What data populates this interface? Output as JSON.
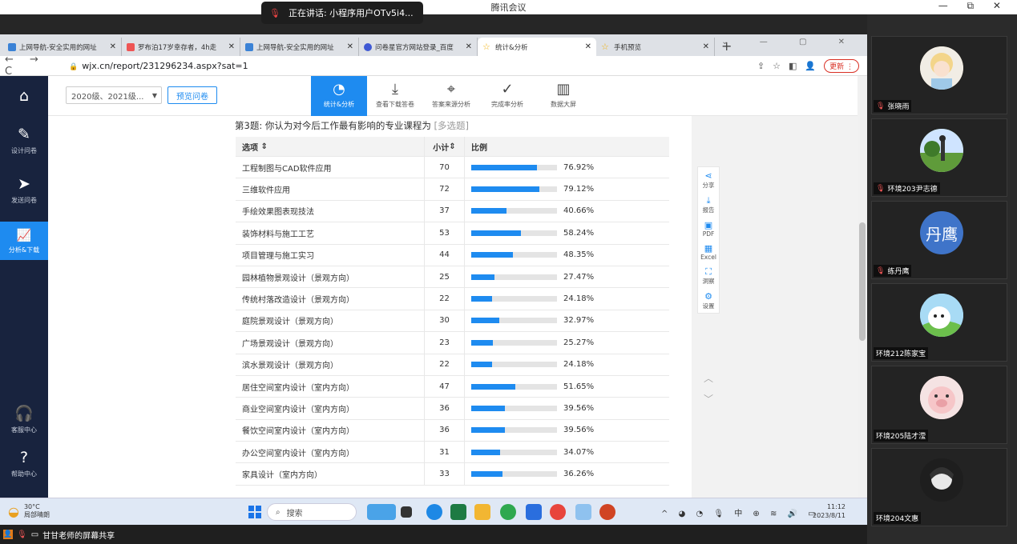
{
  "meeting": {
    "app_title": "腾讯会议",
    "window_controls": "— ⧉ ✕",
    "speaking_label": "正在讲话: 小程序用户OTv5i4...",
    "share_label": "甘甘老师的屏幕共享"
  },
  "browser": {
    "tabs": [
      {
        "label": "上网导航-安全实用的网址",
        "icon": "nav-icon",
        "active": false
      },
      {
        "label": "罗布泊17岁幸存者，4h走",
        "icon": "video-icon",
        "active": false
      },
      {
        "label": "上网导航-安全实用的网址",
        "icon": "nav-icon",
        "active": false
      },
      {
        "label": "问卷星官方网站登录_百度",
        "icon": "paw-icon",
        "active": false
      },
      {
        "label": "统计&分析",
        "icon": "star-icon",
        "active": true
      },
      {
        "label": "手机预览",
        "icon": "star-icon",
        "active": false
      }
    ],
    "url": "wjx.cn/report/231296234.aspx?sat=1",
    "update_label": "更新"
  },
  "sidebar": {
    "items": [
      {
        "label": "设计问卷",
        "icon": "edit-icon"
      },
      {
        "label": "发送问卷",
        "icon": "send-icon"
      },
      {
        "label": "分析&下载",
        "icon": "chart-icon",
        "active": true
      },
      {
        "label": "客服中心",
        "icon": "headset-icon"
      },
      {
        "label": "帮助中心",
        "icon": "help-icon"
      }
    ]
  },
  "toolbar": {
    "year_select": "2020级、2021级...",
    "preview_button": "预览问卷",
    "tools": [
      {
        "label": "统计&分析",
        "icon": "pie-icon",
        "active": true
      },
      {
        "label": "查看下载答卷",
        "icon": "download-icon"
      },
      {
        "label": "答案来源分析",
        "icon": "target-icon"
      },
      {
        "label": "完成率分析",
        "icon": "check-icon"
      },
      {
        "label": "数据大屏",
        "icon": "dashboard-icon"
      }
    ]
  },
  "question": {
    "title": "第3题: 你认为对今后工作最有影响的专业课程为",
    "type_tag": "[多选题]",
    "headers": {
      "option": "选项",
      "count": "小计",
      "ratio": "比例"
    },
    "rows": [
      {
        "option": "工程制图与CAD软件应用",
        "count": "70",
        "percent": "76.92%",
        "value": 76.92
      },
      {
        "option": "三维软件应用",
        "count": "72",
        "percent": "79.12%",
        "value": 79.12
      },
      {
        "option": "手绘效果图表现技法",
        "count": "37",
        "percent": "40.66%",
        "value": 40.66
      },
      {
        "option": "装饰材料与施工工艺",
        "count": "53",
        "percent": "58.24%",
        "value": 58.24
      },
      {
        "option": "项目管理与施工实习",
        "count": "44",
        "percent": "48.35%",
        "value": 48.35
      },
      {
        "option": "园林植物景观设计（景观方向）",
        "count": "25",
        "percent": "27.47%",
        "value": 27.47
      },
      {
        "option": "传统村落改造设计（景观方向）",
        "count": "22",
        "percent": "24.18%",
        "value": 24.18
      },
      {
        "option": "庭院景观设计（景观方向）",
        "count": "30",
        "percent": "32.97%",
        "value": 32.97
      },
      {
        "option": "广场景观设计（景观方向）",
        "count": "23",
        "percent": "25.27%",
        "value": 25.27
      },
      {
        "option": "滨水景观设计（景观方向）",
        "count": "22",
        "percent": "24.18%",
        "value": 24.18
      },
      {
        "option": "居住空间室内设计（室内方向）",
        "count": "47",
        "percent": "51.65%",
        "value": 51.65
      },
      {
        "option": "商业空间室内设计（室内方向）",
        "count": "36",
        "percent": "39.56%",
        "value": 39.56
      },
      {
        "option": "餐饮空间室内设计（室内方向）",
        "count": "36",
        "percent": "39.56%",
        "value": 39.56
      },
      {
        "option": "办公空间室内设计（室内方向）",
        "count": "31",
        "percent": "34.07%",
        "value": 34.07
      },
      {
        "option": "家具设计（室内方向）",
        "count": "33",
        "percent": "36.26%",
        "value": 36.26
      }
    ]
  },
  "right_tools": [
    {
      "label": "分享",
      "icon": "share-icon"
    },
    {
      "label": "报告",
      "icon": "report-icon"
    },
    {
      "label": "PDF",
      "icon": "pdf-icon"
    },
    {
      "label": "Excel",
      "icon": "excel-icon"
    },
    {
      "label": "洞察",
      "icon": "insight-icon"
    },
    {
      "label": "设置",
      "icon": "settings-icon"
    }
  ],
  "taskbar": {
    "weather_temp": "30°C",
    "weather_desc": "局部晴朗",
    "search_label": "搜索",
    "time": "11:12",
    "date": "2023/8/11"
  },
  "participants": [
    {
      "name": "张晓雨",
      "muted": true
    },
    {
      "name": "环境203尹志德",
      "muted": true
    },
    {
      "name": "练丹鹰",
      "muted": true,
      "avatar_text": "丹鹰"
    },
    {
      "name": "环境212陈家宝",
      "muted": false
    },
    {
      "name": "环境205陆才滢",
      "muted": false
    },
    {
      "name": "环境204文惠",
      "muted": false
    }
  ],
  "colors": {
    "accent": "#1e8bf0",
    "sidebar": "#18233e",
    "bar_bg": "#e4e4e4"
  }
}
